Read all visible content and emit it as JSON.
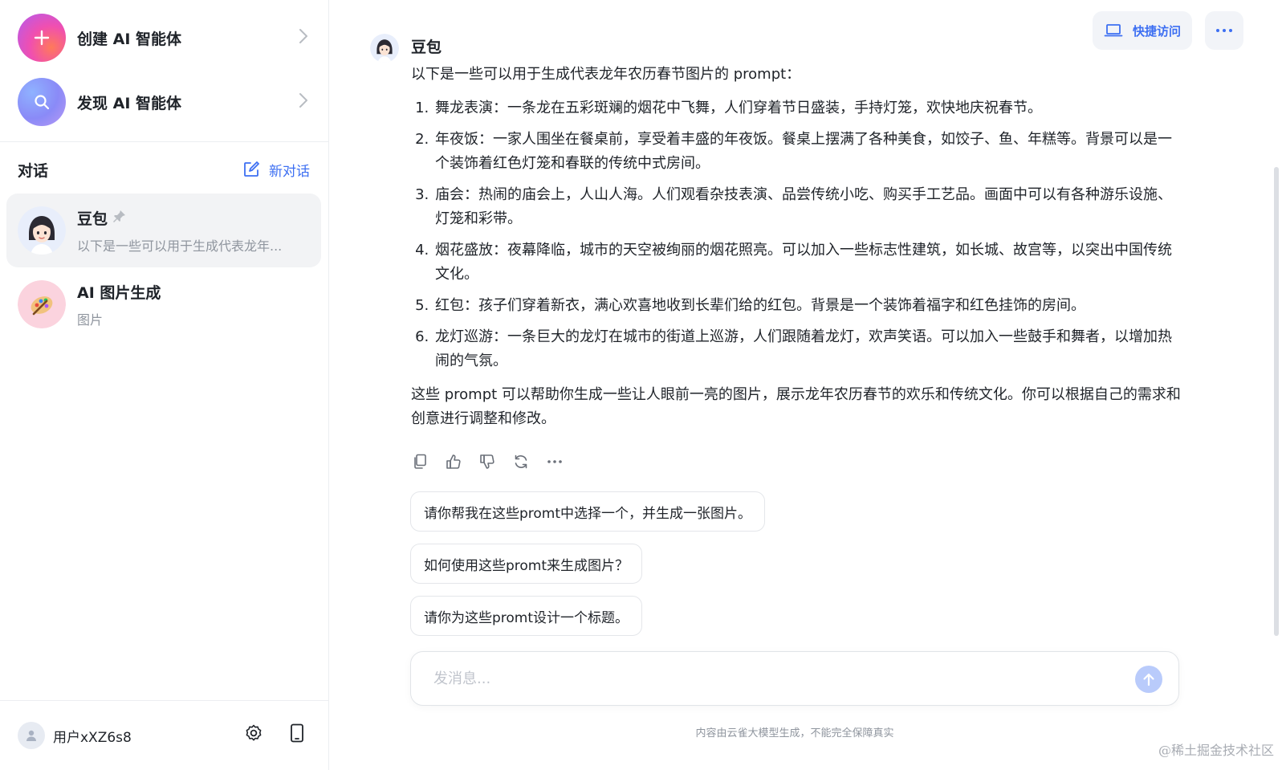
{
  "sidebar": {
    "create_agent": "创建 AI 智能体",
    "discover_agent": "发现 AI 智能体",
    "conversations_title": "对话",
    "new_chat": "新对话",
    "conversations": [
      {
        "name": "豆包",
        "preview": "以下是一些可以用于生成代表龙年...",
        "pinned": true,
        "active": true
      },
      {
        "name": "AI 图片生成",
        "preview": "图片",
        "pinned": false,
        "active": false
      }
    ],
    "user_name": "用户xXZ6s8"
  },
  "header": {
    "quick_access": "快捷访问"
  },
  "message": {
    "bot_name": "豆包",
    "intro": "以下是一些可以用于生成代表龙年农历春节图片的 prompt：",
    "items": [
      "舞龙表演：一条龙在五彩斑斓的烟花中飞舞，人们穿着节日盛装，手持灯笼，欢快地庆祝春节。",
      "年夜饭：一家人围坐在餐桌前，享受着丰盛的年夜饭。餐桌上摆满了各种美食，如饺子、鱼、年糕等。背景可以是一个装饰着红色灯笼和春联的传统中式房间。",
      "庙会：热闹的庙会上，人山人海。人们观看杂技表演、品尝传统小吃、购买手工艺品。画面中可以有各种游乐设施、灯笼和彩带。",
      "烟花盛放：夜幕降临，城市的天空被绚丽的烟花照亮。可以加入一些标志性建筑，如长城、故宫等，以突出中国传统文化。",
      "红包：孩子们穿着新衣，满心欢喜地收到长辈们给的红包。背景是一个装饰着福字和红色挂饰的房间。",
      "龙灯巡游：一条巨大的龙灯在城市的街道上巡游，人们跟随着龙灯，欢声笑语。可以加入一些鼓手和舞者，以增加热闹的气氛。"
    ],
    "outro": "这些 prompt 可以帮助你生成一些让人眼前一亮的图片，展示龙年农历春节的欢乐和传统文化。你可以根据自己的需求和创意进行调整和修改。"
  },
  "suggestions": [
    "请你帮我在这些promt中选择一个，并生成一张图片。",
    "如何使用这些promt来生成图片？",
    "请你为这些promt设计一个标题。"
  ],
  "input": {
    "placeholder": "发消息...",
    "value": ""
  },
  "disclaimer": "内容由云雀大模型生成，不能完全保障真实",
  "watermark": "@稀土掘金技术社区",
  "colors": {
    "accent": "#3d6ff2",
    "active_bg": "#f2f3f5",
    "muted_text": "#8f959e"
  }
}
